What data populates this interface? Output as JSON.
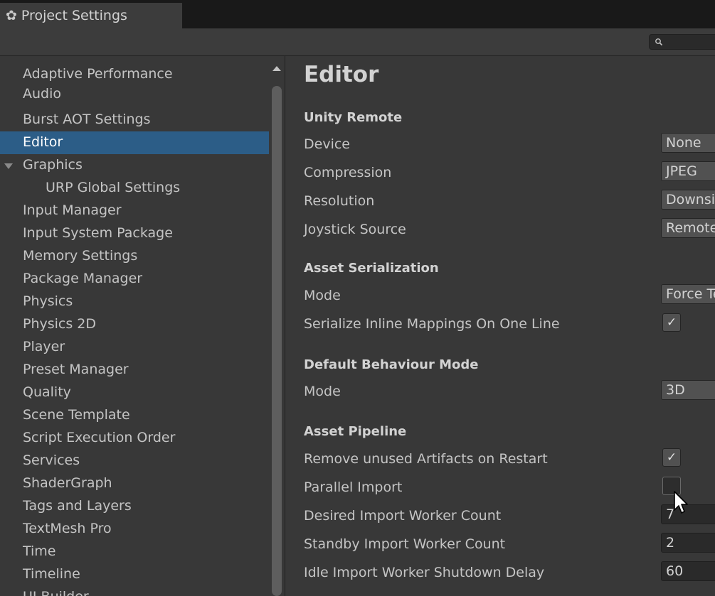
{
  "window": {
    "tab_title": "Project Settings",
    "tab_icon": "gear-icon"
  },
  "search": {
    "placeholder": ""
  },
  "sidebar": {
    "items": [
      {
        "label": "Adaptive Performance"
      },
      {
        "label": "Audio"
      },
      {
        "label": "Burst AOT Settings"
      },
      {
        "label": "Editor",
        "selected": true
      },
      {
        "label": "Graphics",
        "expanded": true
      },
      {
        "label": "URP Global Settings",
        "child": true
      },
      {
        "label": "Input Manager"
      },
      {
        "label": "Input System Package"
      },
      {
        "label": "Memory Settings"
      },
      {
        "label": "Package Manager"
      },
      {
        "label": "Physics"
      },
      {
        "label": "Physics 2D"
      },
      {
        "label": "Player"
      },
      {
        "label": "Preset Manager"
      },
      {
        "label": "Quality"
      },
      {
        "label": "Scene Template"
      },
      {
        "label": "Script Execution Order"
      },
      {
        "label": "Services"
      },
      {
        "label": "ShaderGraph"
      },
      {
        "label": "Tags and Layers"
      },
      {
        "label": "TextMesh Pro"
      },
      {
        "label": "Time"
      },
      {
        "label": "Timeline"
      },
      {
        "label": "UI Builder"
      }
    ]
  },
  "main": {
    "title": "Editor",
    "unity_remote": {
      "header": "Unity Remote",
      "device": {
        "label": "Device",
        "value": "None"
      },
      "compression": {
        "label": "Compression",
        "value": "JPEG"
      },
      "resolution": {
        "label": "Resolution",
        "value": "Downsize"
      },
      "joystick_source": {
        "label": "Joystick Source",
        "value": "Remote"
      }
    },
    "asset_serialization": {
      "header": "Asset Serialization",
      "mode": {
        "label": "Mode",
        "value": "Force Text"
      },
      "inline_mappings": {
        "label": "Serialize Inline Mappings On One Line",
        "checked": true
      }
    },
    "default_behaviour": {
      "header": "Default Behaviour Mode",
      "mode": {
        "label": "Mode",
        "value": "3D"
      }
    },
    "asset_pipeline": {
      "header": "Asset Pipeline",
      "remove_unused": {
        "label": "Remove unused Artifacts on Restart",
        "checked": true
      },
      "parallel_import": {
        "label": "Parallel Import",
        "checked": false
      },
      "desired_worker_count": {
        "label": "Desired Import Worker Count",
        "value": "7"
      },
      "standby_worker_count": {
        "label": "Standby Import Worker Count",
        "value": "2"
      },
      "idle_shutdown_delay": {
        "label": "Idle Import Worker Shutdown Delay",
        "value": "60"
      }
    }
  },
  "checkmark_glyph": "✓"
}
